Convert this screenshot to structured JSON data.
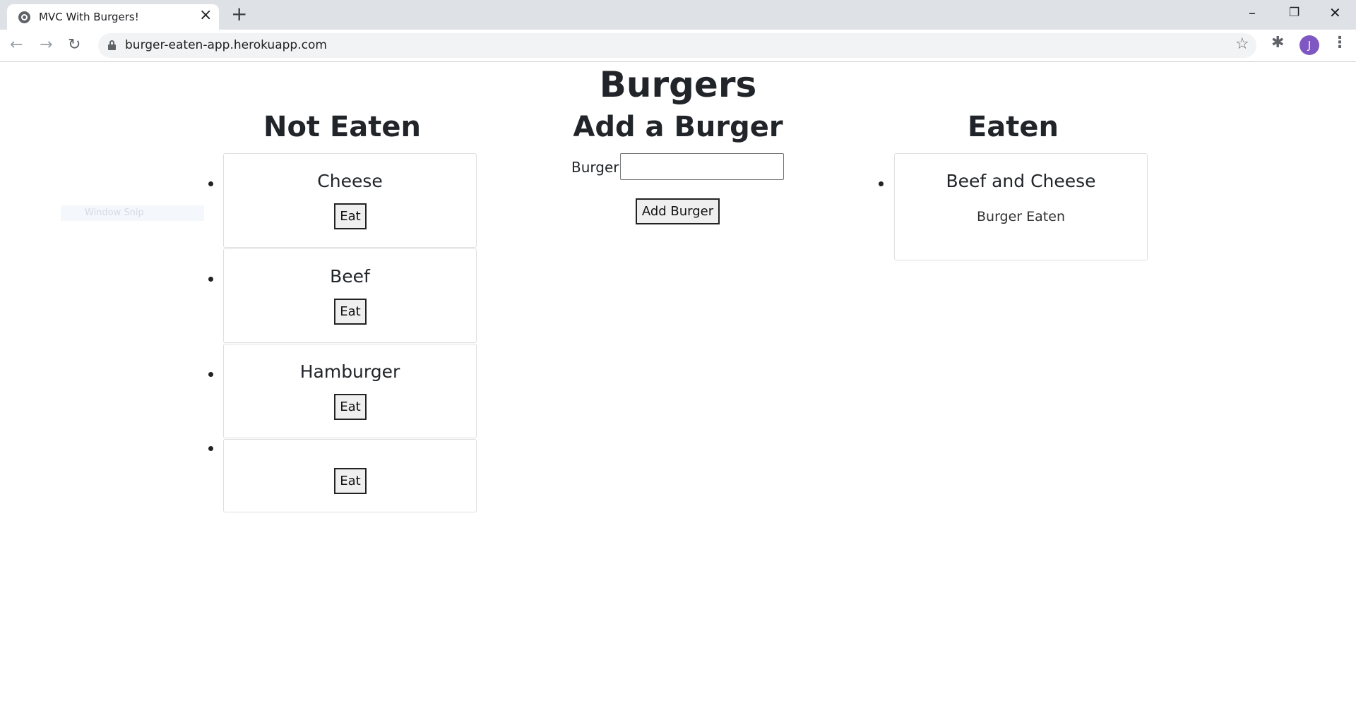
{
  "browser": {
    "tab_title": "MVC With Burgers!",
    "url": "burger-eaten-app.herokuapp.com",
    "avatar_letter": "J"
  },
  "page": {
    "title": "Burgers",
    "not_eaten": {
      "heading": "Not Eaten",
      "items": [
        {
          "name": "Cheese",
          "button": "Eat"
        },
        {
          "name": "Beef",
          "button": "Eat"
        },
        {
          "name": "Hamburger",
          "button": "Eat"
        },
        {
          "name": "",
          "button": "Eat"
        }
      ]
    },
    "add": {
      "heading": "Add a Burger",
      "label": "Burger:",
      "input_value": "",
      "button": "Add Burger"
    },
    "eaten": {
      "heading": "Eaten",
      "items": [
        {
          "name": "Beef and Cheese",
          "status": "Burger Eaten"
        }
      ]
    },
    "overlay_text": "Window Snip"
  }
}
